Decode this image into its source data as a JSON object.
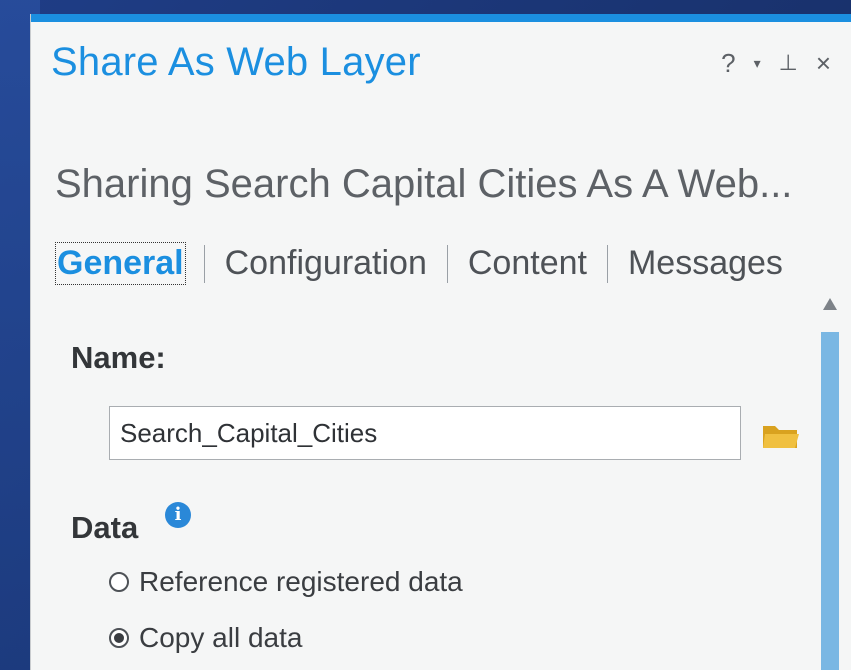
{
  "pane": {
    "title": "Share As Web Layer",
    "controls": {
      "help": "?",
      "menu": "▾",
      "pin": "⊥",
      "close": "×"
    },
    "subtitle": "Sharing Search Capital Cities As A Web...",
    "tabs": [
      {
        "label": "General",
        "active": true
      },
      {
        "label": "Configuration",
        "active": false
      },
      {
        "label": "Content",
        "active": false
      },
      {
        "label": "Messages",
        "active": false
      }
    ]
  },
  "general": {
    "name_label": "Name:",
    "name_value": "Search_Capital_Cities",
    "data_label": "Data",
    "data_options": [
      {
        "label": "Reference registered data",
        "selected": false
      },
      {
        "label": "Copy all data",
        "selected": true
      }
    ]
  },
  "icons": {
    "browse": "folder-icon",
    "info": "info-icon"
  },
  "colors": {
    "accent": "#1b8fe0",
    "folder": "#e9b52b",
    "info": "#2a88d8",
    "scroll_thumb": "#7ab7e3"
  }
}
